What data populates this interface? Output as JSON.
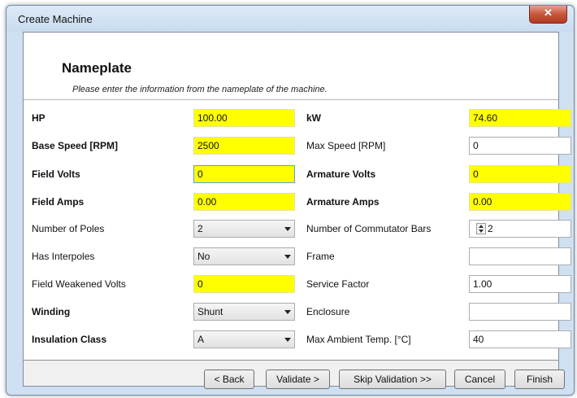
{
  "window": {
    "title": "Create Machine",
    "close_glyph": "✕"
  },
  "header": {
    "title": "Nameplate",
    "subtitle": "Please enter the information from the nameplate of the machine."
  },
  "fields": {
    "hp": {
      "label": "HP",
      "value": "100.00"
    },
    "kw": {
      "label": "kW",
      "value": "74.60"
    },
    "base_speed": {
      "label": "Base Speed [RPM]",
      "value": "2500"
    },
    "max_speed": {
      "label": "Max Speed [RPM]",
      "value": "0"
    },
    "field_volts": {
      "label": "Field Volts",
      "value": "0"
    },
    "armature_volts": {
      "label": "Armature Volts",
      "value": "0"
    },
    "field_amps": {
      "label": "Field Amps",
      "value": "0.00"
    },
    "armature_amps": {
      "label": "Armature Amps",
      "value": "0.00"
    },
    "number_of_poles": {
      "label": "Number of Poles",
      "value": "2"
    },
    "commutator_bars": {
      "label": "Number of Commutator Bars",
      "value": "2"
    },
    "has_interpoles": {
      "label": "Has Interpoles",
      "value": "No"
    },
    "frame": {
      "label": "Frame",
      "value": ""
    },
    "field_weakened_volts": {
      "label": "Field Weakened Volts",
      "value": "0"
    },
    "service_factor": {
      "label": "Service Factor",
      "value": "1.00"
    },
    "winding": {
      "label": "Winding",
      "value": "Shunt"
    },
    "enclosure": {
      "label": "Enclosure",
      "value": ""
    },
    "insulation_class": {
      "label": "Insulation Class",
      "value": "A"
    },
    "max_ambient_temp": {
      "label": "Max Ambient Temp. [°C]",
      "value": "40"
    }
  },
  "buttons": {
    "back": "< Back",
    "validate": "Validate >",
    "skip_validation": "Skip Validation >>",
    "cancel": "Cancel",
    "finish": "Finish"
  },
  "colors": {
    "required_highlight": "#ffff00",
    "close_button": "#c8553c"
  },
  "icons": {
    "close": "close-icon",
    "dropdown": "chevron-down-icon",
    "spinner": "spinner-arrows-icon"
  }
}
